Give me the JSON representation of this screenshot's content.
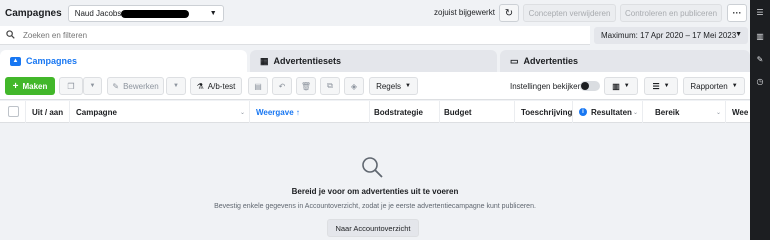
{
  "header": {
    "title": "Campagnes",
    "account_name": "Naud Jacobs",
    "saved_status": "zojuist bijgewerkt",
    "discard_label": "Concepten verwijderen",
    "review_publish_label": "Controleren en publiceren",
    "more_label": "···"
  },
  "search": {
    "placeholder": "Zoeken en filteren",
    "date_range": "Maximum: 17 Apr 2020 – 17 Mei 2023"
  },
  "tabs": [
    {
      "label": "Campagnes"
    },
    {
      "label": "Advertentiesets"
    },
    {
      "label": "Advertenties"
    }
  ],
  "toolbar": {
    "create_label": "Maken",
    "edit_label": "Bewerken",
    "ab_test_label": "A/b-test",
    "rules_label": "Regels",
    "view_settings_label": "Instellingen bekijken",
    "reports_label": "Rapporten"
  },
  "table": {
    "columns": [
      "Uit / aan",
      "Campagne",
      "Weergave ↑",
      "Bodstrategie",
      "Budget",
      "Toeschrijvingsi",
      "Resultaten",
      "Bereik",
      "Wee"
    ]
  },
  "empty_state": {
    "title": "Bereid je voor om advertenties uit te voeren",
    "subtitle": "Bevestig enkele gegevens in Accountoverzicht, zodat je je eerste advertentiecampagne kunt publiceren.",
    "button_label": "Naar Accountoverzicht"
  },
  "colors": {
    "accent": "#1877f2",
    "create_green": "#42b72a"
  }
}
